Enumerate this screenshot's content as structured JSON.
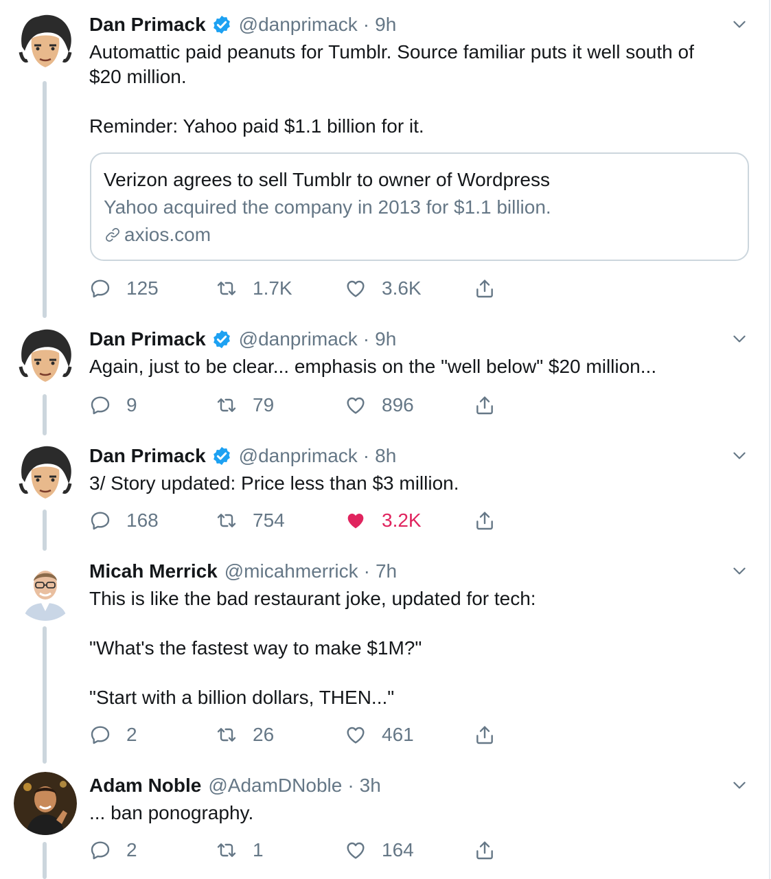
{
  "tweets": [
    {
      "name": "Dan Primack",
      "handle": "@danprimack",
      "time": "9h",
      "lines": [
        "Automattic paid peanuts for Tumblr. Source familiar puts it well south of",
        "$20 million."
      ],
      "lines2": [
        "Reminder: Yahoo paid $1.1 billion for it."
      ],
      "card": {
        "title": "Verizon agrees to sell Tumblr to owner of Wordpress",
        "description": "Yahoo acquired the company in 2013 for $1.1 billion.",
        "domain": "axios.com"
      },
      "replies": "125",
      "retweets": "1.7K",
      "likes": "3.6K"
    },
    {
      "name": "Dan Primack",
      "handle": "@danprimack",
      "time": "9h",
      "lines": [
        "Again, just to be clear... emphasis on the \"well below\" $20 million..."
      ],
      "replies": "9",
      "retweets": "79",
      "likes": "896"
    },
    {
      "name": "Dan Primack",
      "handle": "@danprimack",
      "time": "8h",
      "lines": [
        "3/ Story updated: Price less than $3 million."
      ],
      "replies": "168",
      "retweets": "754",
      "likes": "3.2K",
      "liked": true
    },
    {
      "name": "Micah Merrick",
      "handle": "@micahmerrick",
      "time": "7h",
      "lines": [
        "This is like the bad restaurant joke, updated for tech:"
      ],
      "lines2": [
        "\"What's the fastest way to make $1M?\""
      ],
      "lines3": [
        "\"Start with a billion dollars, THEN...\""
      ],
      "replies": "2",
      "retweets": "26",
      "likes": "461"
    },
    {
      "name": "Adam Noble",
      "handle": "@AdamDNoble",
      "time": "3h",
      "lines": [
        "... ban ponography."
      ],
      "replies": "2",
      "retweets": "1",
      "likes": "164"
    }
  ],
  "sep": "·",
  "colors": {
    "accent": "#1da1f2",
    "like": "#e0245e",
    "muted": "#657786",
    "line": "#ccd6dd"
  }
}
